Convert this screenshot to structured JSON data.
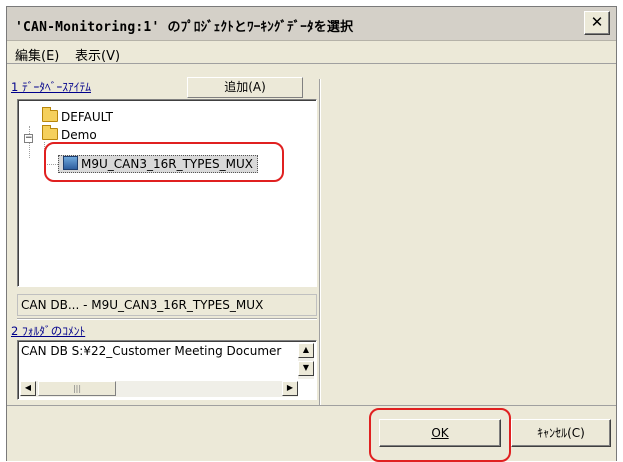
{
  "window": {
    "title": "'CAN-Monitoring:1' のﾌﾟﾛｼﾞｪｸﾄとﾜｰｷﾝｸﾞﾃﾞｰﾀを選択",
    "close_symbol": "✕"
  },
  "menu": [
    {
      "label": "編集(E)"
    },
    {
      "label": "表示(V)"
    }
  ],
  "database_section": {
    "label": "1 ﾃﾞｰﾀﾍﾞｰｽｱｲﾃﾑ",
    "add_button": "追加(A)"
  },
  "tree": {
    "items": [
      {
        "label": "DEFAULT",
        "icon": "folder-icon"
      },
      {
        "label": "Demo",
        "icon": "folder-icon",
        "expander": "−"
      },
      {
        "label": "M9U_CAN3_16R_TYPES_MUX",
        "icon": "database-icon",
        "selected": true
      }
    ]
  },
  "selected_path": "CAN DB... - M9U_CAN3_16R_TYPES_MUX",
  "comment_section": {
    "label": "2 ﾌｫﾙﾀﾞのｺﾒﾝﾄ",
    "text": "CAN DB S:¥22_Customer Meeting Documer"
  },
  "scrollbar": {
    "up": "▲",
    "down": "▼",
    "left": "◀",
    "right": "▶",
    "thumb": "|||"
  },
  "buttons": {
    "ok": "OK",
    "cancel": "ｷｬﾝｾﾙ(C)"
  },
  "highlight_color": "#e02020"
}
